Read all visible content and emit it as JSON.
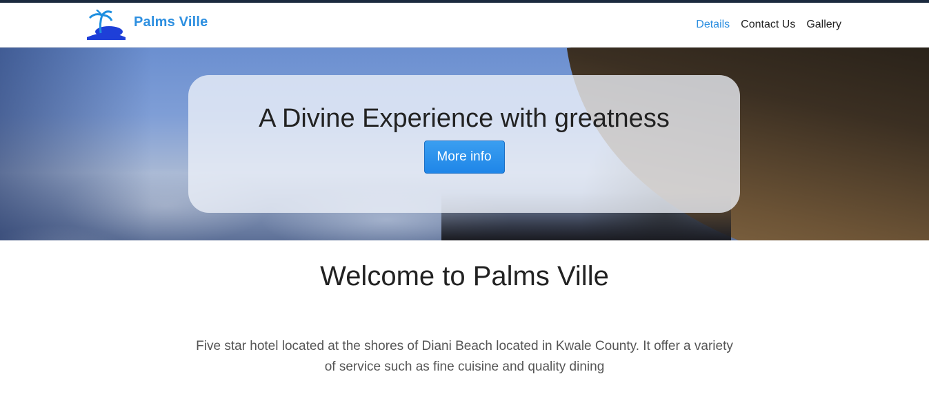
{
  "brand": {
    "name": "Palms Ville",
    "logo_icon": "palm-tree-island-icon",
    "brand_color": "#2d8fe0"
  },
  "nav": {
    "items": [
      {
        "label": "Details",
        "active": true
      },
      {
        "label": "Contact Us",
        "active": false
      },
      {
        "label": "Gallery",
        "active": false
      }
    ]
  },
  "hero": {
    "headline": "A Divine Experience with greatness",
    "button_label": "More info"
  },
  "welcome": {
    "title": "Welcome to Palms Ville",
    "description": "Five star hotel located at the shores of Diani Beach located in Kwale County. It offer a variety of service such as fine cuisine and quality dining"
  }
}
